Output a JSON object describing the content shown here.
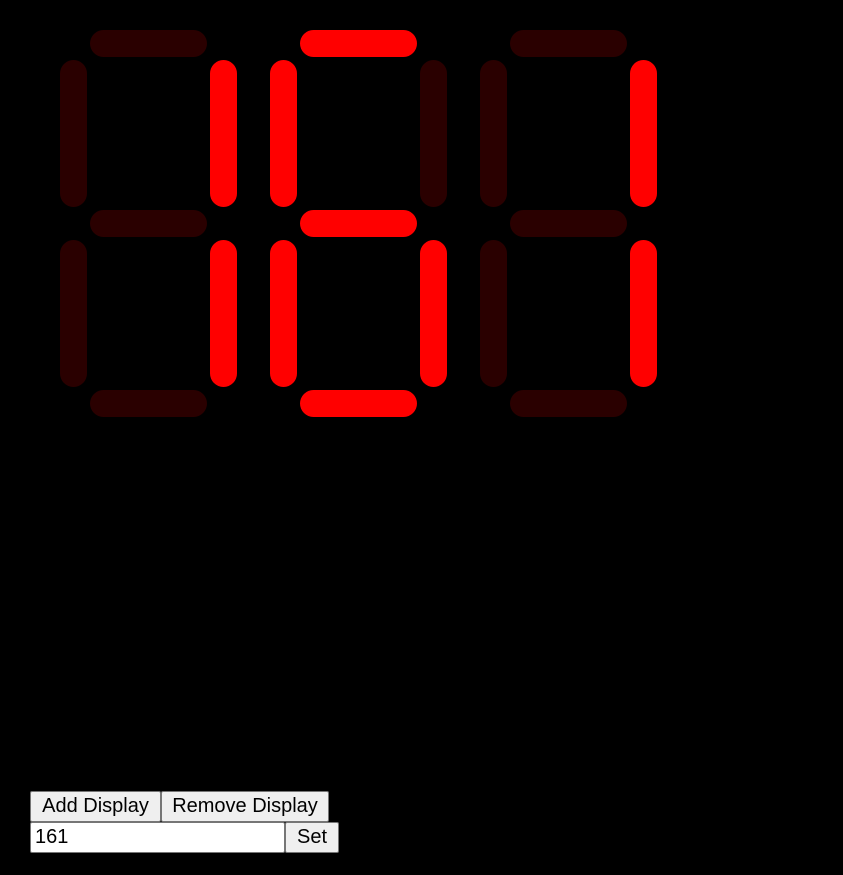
{
  "display": {
    "value": "161",
    "colors": {
      "on": "#ff0000",
      "off": "#2a0000",
      "background": "#000000"
    },
    "digits": [
      {
        "char": "1",
        "segments": {
          "a": false,
          "b": true,
          "c": true,
          "d": false,
          "e": false,
          "f": false,
          "g": false
        }
      },
      {
        "char": "6",
        "segments": {
          "a": true,
          "b": false,
          "c": true,
          "d": true,
          "e": true,
          "f": true,
          "g": true
        }
      },
      {
        "char": "1",
        "segments": {
          "a": false,
          "b": true,
          "c": true,
          "d": false,
          "e": false,
          "f": false,
          "g": false
        }
      }
    ]
  },
  "controls": {
    "add_label": "Add Display",
    "remove_label": "Remove Display",
    "input_value": "161",
    "set_label": "Set"
  }
}
